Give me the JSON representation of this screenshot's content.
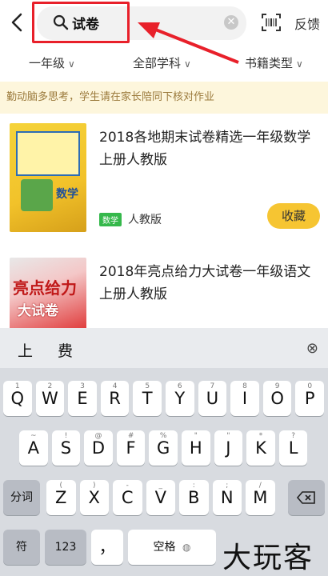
{
  "header": {
    "search_value": "试卷",
    "clear_icon": "clear-icon",
    "feedback_label": "反馈"
  },
  "filters": [
    {
      "label": "一年级"
    },
    {
      "label": "全部学科"
    },
    {
      "label": "书籍类型"
    }
  ],
  "notice": "勤动脑多思考，学生请在家长陪同下核对作业",
  "books": [
    {
      "title": "2018各地期末试卷精选一年级数学上册人教版",
      "subject_tag": "数学",
      "publisher": "人教版",
      "collect_label": "收藏",
      "cover_text": "数学"
    },
    {
      "title": "2018年亮点给力大试卷一年级语文上册人教版",
      "cover_text": "亮点给力",
      "cover_subtext": "大试卷"
    }
  ],
  "keyboard": {
    "candidates": [
      "上",
      "费"
    ],
    "row1": [
      {
        "key": "Q",
        "sub": "1"
      },
      {
        "key": "W",
        "sub": "2"
      },
      {
        "key": "E",
        "sub": "3"
      },
      {
        "key": "R",
        "sub": "4"
      },
      {
        "key": "T",
        "sub": "5"
      },
      {
        "key": "Y",
        "sub": "6"
      },
      {
        "key": "U",
        "sub": "7"
      },
      {
        "key": "I",
        "sub": "8"
      },
      {
        "key": "O",
        "sub": "9"
      },
      {
        "key": "P",
        "sub": "0"
      }
    ],
    "row2": [
      {
        "key": "A",
        "sub": "~"
      },
      {
        "key": "S",
        "sub": "!"
      },
      {
        "key": "D",
        "sub": "@"
      },
      {
        "key": "F",
        "sub": "#"
      },
      {
        "key": "G",
        "sub": "%"
      },
      {
        "key": "H",
        "sub": "\""
      },
      {
        "key": "J",
        "sub": "\""
      },
      {
        "key": "K",
        "sub": "*"
      },
      {
        "key": "L",
        "sub": "?"
      }
    ],
    "row3": [
      {
        "key": "Z",
        "sub": "("
      },
      {
        "key": "X",
        "sub": ")"
      },
      {
        "key": "C",
        "sub": "-"
      },
      {
        "key": "V",
        "sub": "_"
      },
      {
        "key": "B",
        "sub": ":"
      },
      {
        "key": "N",
        "sub": ";"
      },
      {
        "key": "M",
        "sub": "/"
      }
    ],
    "fenci_label": "分词",
    "fu_label": "符",
    "num_label": "123",
    "comma_label": "，",
    "space_label": "空格"
  },
  "watermark": "大玩客",
  "colors": {
    "accent": "#f6c532",
    "highlight": "#e8202a",
    "tag_green": "#35b84b",
    "notice_bg": "#fdf6dc"
  }
}
